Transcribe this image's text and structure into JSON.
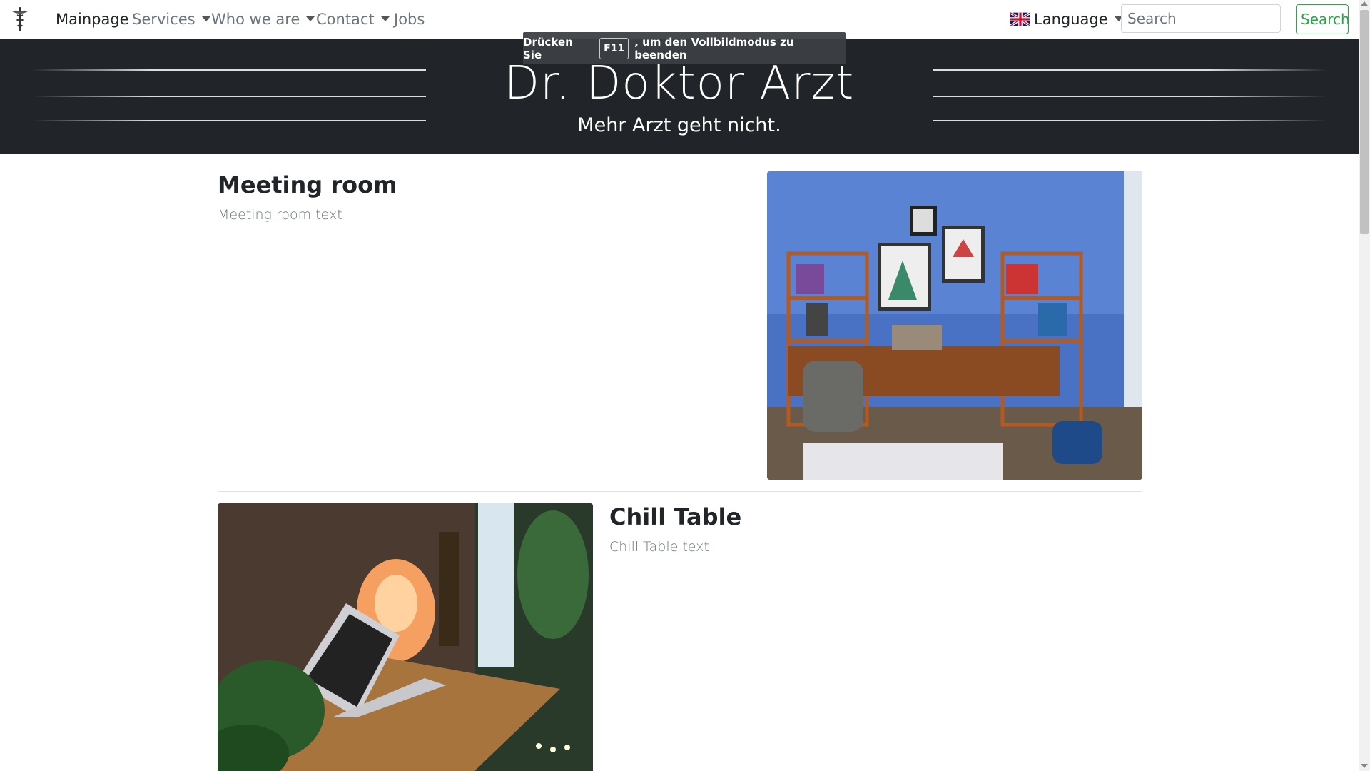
{
  "navbar": {
    "brand_icon": "caduceus-icon",
    "items": [
      {
        "label": "Mainpage",
        "dropdown": false,
        "active": true
      },
      {
        "label": "Services",
        "dropdown": true,
        "active": false
      },
      {
        "label": "Who we are",
        "dropdown": true,
        "active": false
      },
      {
        "label": "Contact",
        "dropdown": true,
        "active": false
      },
      {
        "label": "Jobs",
        "dropdown": false,
        "active": false
      }
    ],
    "language": {
      "label": "Language",
      "flag_icon": "uk-flag-icon"
    },
    "search": {
      "placeholder": "Search",
      "value": "",
      "button_label": "Search"
    }
  },
  "fullscreen_notice": {
    "prefix": "Drücken Sie",
    "key": "F11",
    "suffix": ", um den Vollbildmodus zu beenden"
  },
  "header": {
    "title": "Dr. Doktor Arzt",
    "subtitle": "Mehr Arzt geht nicht."
  },
  "sections": [
    {
      "heading": "Meeting room",
      "text": "Meeting room text",
      "image": "office-room-photo"
    },
    {
      "heading": "Chill Table",
      "text": "Chill Table text",
      "image": "laptop-desk-photo"
    }
  ],
  "colors": {
    "header_bg": "#212529",
    "search_accent": "#28a745",
    "nav_muted": "#6c757d"
  }
}
